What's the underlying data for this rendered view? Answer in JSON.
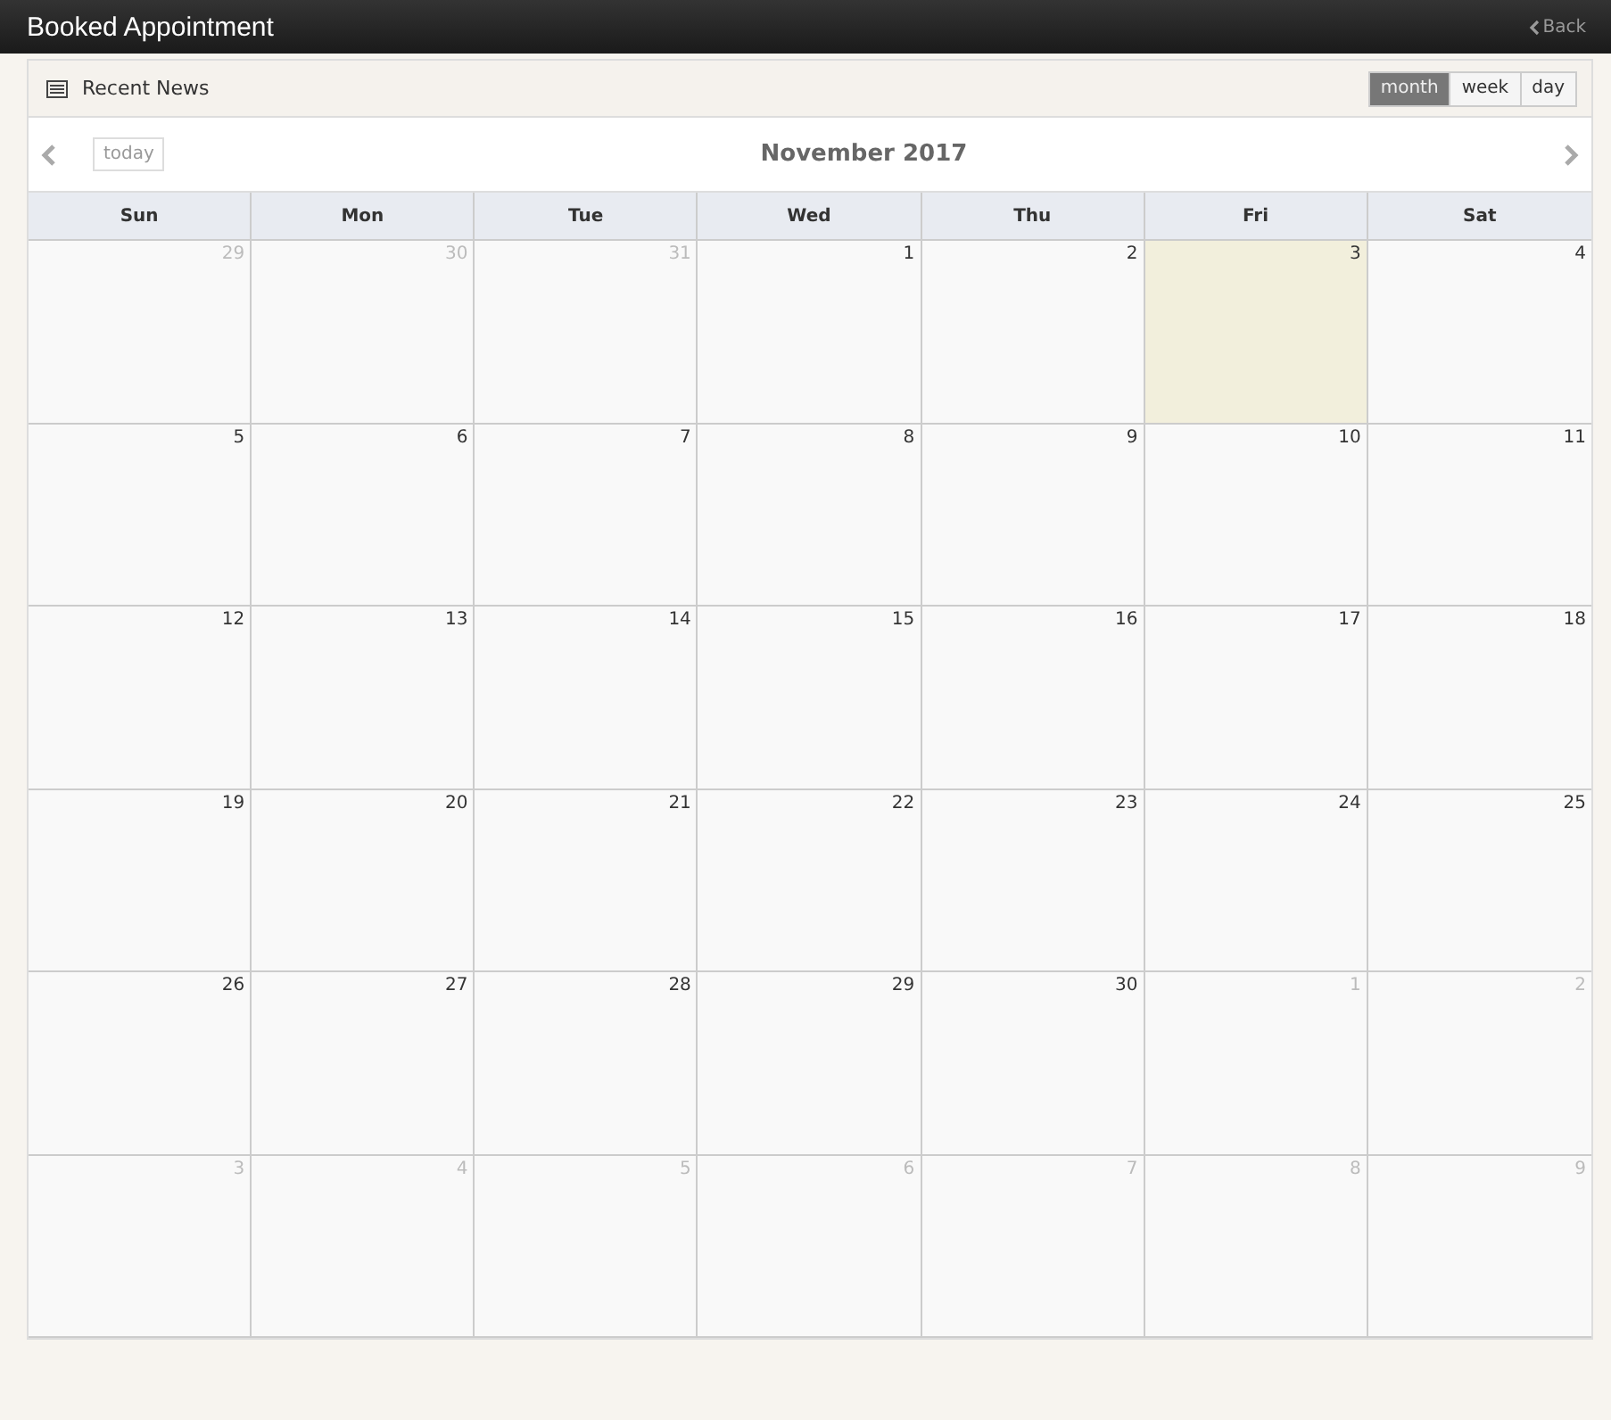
{
  "window": {
    "title": "Booked Appointment",
    "back": "Back"
  },
  "panel": {
    "title": "Recent News"
  },
  "views": [
    {
      "label": "month",
      "selected": true
    },
    {
      "label": "week",
      "selected": false
    },
    {
      "label": "day",
      "selected": false
    }
  ],
  "toolbar": {
    "today": "today",
    "title": "November 2017"
  },
  "weekdays": [
    "Sun",
    "Mon",
    "Tue",
    "Wed",
    "Thu",
    "Fri",
    "Sat"
  ],
  "weeks": [
    [
      {
        "day": "29",
        "other": true,
        "today": false
      },
      {
        "day": "30",
        "other": true,
        "today": false
      },
      {
        "day": "31",
        "other": true,
        "today": false
      },
      {
        "day": "1",
        "other": false,
        "today": false
      },
      {
        "day": "2",
        "other": false,
        "today": false
      },
      {
        "day": "3",
        "other": false,
        "today": true
      },
      {
        "day": "4",
        "other": false,
        "today": false
      }
    ],
    [
      {
        "day": "5",
        "other": false,
        "today": false
      },
      {
        "day": "6",
        "other": false,
        "today": false
      },
      {
        "day": "7",
        "other": false,
        "today": false
      },
      {
        "day": "8",
        "other": false,
        "today": false
      },
      {
        "day": "9",
        "other": false,
        "today": false
      },
      {
        "day": "10",
        "other": false,
        "today": false
      },
      {
        "day": "11",
        "other": false,
        "today": false
      }
    ],
    [
      {
        "day": "12",
        "other": false,
        "today": false
      },
      {
        "day": "13",
        "other": false,
        "today": false
      },
      {
        "day": "14",
        "other": false,
        "today": false
      },
      {
        "day": "15",
        "other": false,
        "today": false
      },
      {
        "day": "16",
        "other": false,
        "today": false
      },
      {
        "day": "17",
        "other": false,
        "today": false
      },
      {
        "day": "18",
        "other": false,
        "today": false
      }
    ],
    [
      {
        "day": "19",
        "other": false,
        "today": false
      },
      {
        "day": "20",
        "other": false,
        "today": false
      },
      {
        "day": "21",
        "other": false,
        "today": false
      },
      {
        "day": "22",
        "other": false,
        "today": false
      },
      {
        "day": "23",
        "other": false,
        "today": false
      },
      {
        "day": "24",
        "other": false,
        "today": false
      },
      {
        "day": "25",
        "other": false,
        "today": false
      }
    ],
    [
      {
        "day": "26",
        "other": false,
        "today": false
      },
      {
        "day": "27",
        "other": false,
        "today": false
      },
      {
        "day": "28",
        "other": false,
        "today": false
      },
      {
        "day": "29",
        "other": false,
        "today": false
      },
      {
        "day": "30",
        "other": false,
        "today": false
      },
      {
        "day": "1",
        "other": true,
        "today": false
      },
      {
        "day": "2",
        "other": true,
        "today": false
      }
    ],
    [
      {
        "day": "3",
        "other": true,
        "today": false
      },
      {
        "day": "4",
        "other": true,
        "today": false
      },
      {
        "day": "5",
        "other": true,
        "today": false
      },
      {
        "day": "6",
        "other": true,
        "today": false
      },
      {
        "day": "7",
        "other": true,
        "today": false
      },
      {
        "day": "8",
        "other": true,
        "today": false
      },
      {
        "day": "9",
        "other": true,
        "today": false
      }
    ]
  ]
}
